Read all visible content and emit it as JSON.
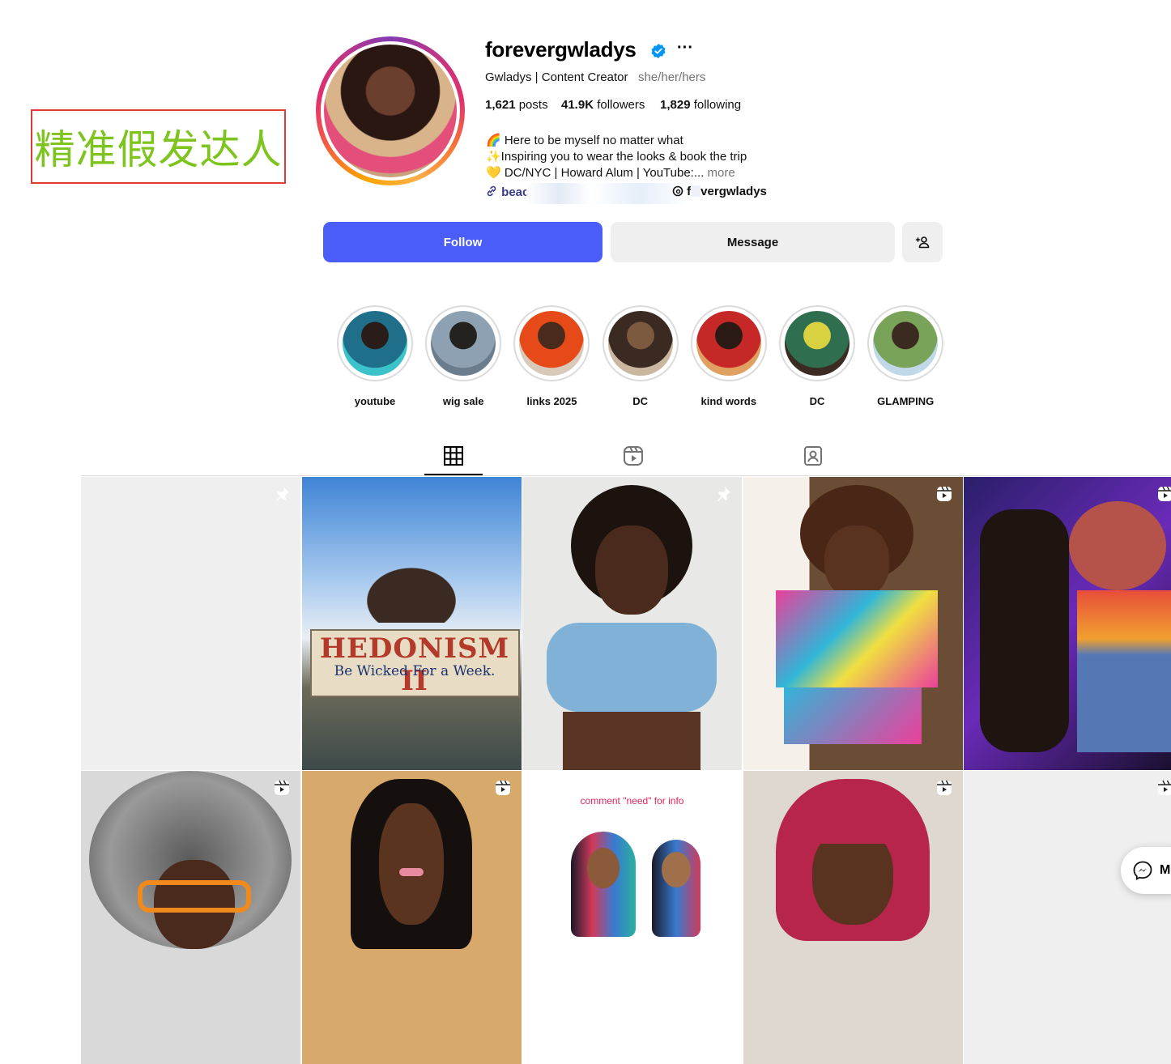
{
  "annotation": {
    "text": "精准假发达人",
    "color": "#7ec41f",
    "border_color": "#e53935"
  },
  "profile": {
    "username": "forevergwladys",
    "verified": true,
    "full_name": "Gwladys | Content Creator",
    "pronouns": "she/her/hers",
    "stats": {
      "posts_count": "1,621",
      "posts_label": " posts",
      "followers_count": "41.9K",
      "followers_label": " followers",
      "following_count": "1,829",
      "following_label": " following"
    },
    "bio": [
      "🌈 Here to be myself no matter what",
      "✨Inspiring you to wear the looks & book the trip",
      "💛 DC/NYC | Howard Alum | YouTube:..."
    ],
    "bio_more": "more",
    "link_text": "beac",
    "threads_handle_prefix": "f",
    "threads_handle": "vergwladys"
  },
  "actions": {
    "follow": "Follow",
    "message": "Message",
    "add_user": "+👤",
    "follow_color": "#4a5df9"
  },
  "highlights": [
    {
      "label": "youtube",
      "colors": [
        "#1f6f8b",
        "#2a1c18",
        "#3cc3c9"
      ]
    },
    {
      "label": "wig sale",
      "colors": [
        "#8ea1b3",
        "#23221f",
        "#6b7d8c"
      ]
    },
    {
      "label": "links 2025",
      "colors": [
        "#e64a19",
        "#4a2a1c",
        "#d8c9b8"
      ]
    },
    {
      "label": "DC",
      "colors": [
        "#3b2a22",
        "#7b5a40",
        "#c9b7a0"
      ]
    },
    {
      "label": "kind words",
      "colors": [
        "#c62828",
        "#2b1a14",
        "#e0a060"
      ]
    },
    {
      "label": "DC",
      "colors": [
        "#2f6f4f",
        "#d8d240",
        "#3c2b22"
      ]
    },
    {
      "label": "GLAMPING",
      "colors": [
        "#7aa35a",
        "#3a2a20",
        "#c0d8e8"
      ]
    }
  ],
  "tabs": [
    {
      "name": "posts",
      "icon": "grid-icon",
      "active": true
    },
    {
      "name": "reels",
      "icon": "reels-icon",
      "active": false
    },
    {
      "name": "tagged",
      "icon": "tagged-icon",
      "active": false
    }
  ],
  "grid": [
    {
      "type": "pinned",
      "bg": "#efefef",
      "desc": ""
    },
    {
      "type": "none",
      "bg": "#7fb4e8",
      "desc": "HEDONISM II",
      "caption": "HEDONISM II",
      "caption2": "Be Wicked For a Week."
    },
    {
      "type": "pinned",
      "bg": "#e8e8e6",
      "desc": ""
    },
    {
      "type": "reel",
      "bg": "#f3ece4",
      "desc": ""
    },
    {
      "type": "reel",
      "bg": "#3a2b7a",
      "desc": ""
    },
    {
      "type": "reel",
      "bg": "#c9c2b8",
      "desc": ""
    },
    {
      "type": "reel",
      "bg": "#d7a96a",
      "desc": ""
    },
    {
      "type": "none",
      "bg": "#ffffff",
      "desc": "",
      "text": "comment \"need\" for info"
    },
    {
      "type": "reel",
      "bg": "#ded8cf",
      "desc": ""
    },
    {
      "type": "reel",
      "bg": "#efefef",
      "desc": ""
    }
  ],
  "messenger": {
    "label": "M"
  }
}
